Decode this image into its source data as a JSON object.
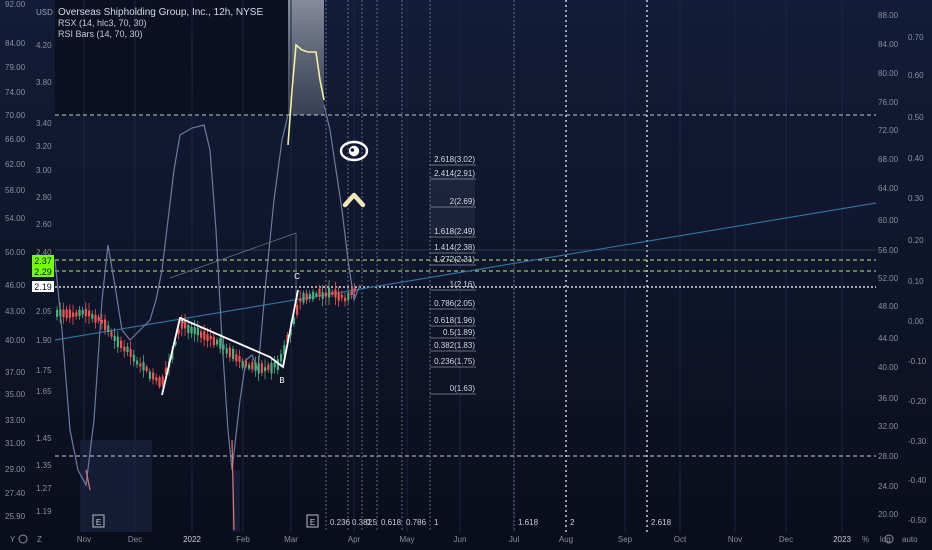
{
  "legend": {
    "title": "Overseas Shipholding Group, Inc., 12h, NYSE",
    "line2": "RSX (14, hlc3, 70, 30)",
    "line3": "RSI Bars (14, 70, 30)",
    "currency": "USD"
  },
  "colors": {
    "background_top": "#10182f",
    "background_bottom": "#0b0f1e",
    "price_marker": "#ffffff",
    "up_candle": "#4caf7d",
    "down_candle": "#ef5350",
    "label_green": "#76ff03",
    "rsx_line": "#6c7a9c",
    "highlight_line": "#f0f0a0",
    "trend_line": "#2f6f9a",
    "fib_line": "#8a8f9e"
  },
  "axes": {
    "left_ticks": [
      "92.00",
      "84.00",
      "79.00",
      "74.00",
      "70.00",
      "66.00",
      "62.00",
      "58.00",
      "54.00",
      "50.00",
      "46.00",
      "43.00",
      "40.00",
      "37.00",
      "35.00",
      "33.00",
      "31.00",
      "29.00",
      "27.40",
      "25.90"
    ],
    "inner_left_ticks": [
      "4.20",
      "3.80",
      "3.40",
      "3.20",
      "3.00",
      "2.80",
      "2.60",
      "2.40",
      "2.05",
      "1.90",
      "1.75",
      "1.65",
      "1.45",
      "1.35",
      "1.27",
      "1.19"
    ],
    "right_price_ticks": [
      "88.00",
      "84.00",
      "80.00",
      "76.00",
      "72.00",
      "68.00",
      "64.00",
      "60.00",
      "56.00",
      "52.00",
      "48.00",
      "44.00",
      "40.00",
      "36.00",
      "32.00",
      "28.00",
      "24.00",
      "20.00"
    ],
    "right_osc_ticks": [
      "0.70",
      "0.60",
      "0.50",
      "0.40",
      "0.30",
      "0.20",
      "0.10",
      "0.00",
      "-0.10",
      "-0.20",
      "-0.30",
      "-0.40",
      "-0.50"
    ],
    "x_ticks": [
      "Nov",
      "Dec",
      "2022",
      "Feb",
      "Mar",
      "Apr",
      "May",
      "Jun",
      "Jul",
      "Aug",
      "Sep",
      "Oct",
      "Nov",
      "Dec",
      "2023"
    ],
    "corner_left": [
      "Y",
      "Z"
    ],
    "corner_right": [
      "%",
      "log",
      "auto"
    ]
  },
  "price_labels": {
    "green_top": "2.37",
    "green_bottom": "2.29",
    "current": "2.19"
  },
  "fib_levels": [
    "2.618(3.02)",
    "2.414(2.91)",
    "2(2.69)",
    "1.618(2.49)",
    "1.414(2.38)",
    "1.272(2.31)",
    "1(2.16)",
    "0.786(2.05)",
    "0.618(1.96)",
    "0.5(1.89)",
    "0.382(1.83)",
    "0.236(1.75)",
    "0(1.63)"
  ],
  "time_fib_labels": [
    "0.236",
    "0.382",
    "0.5",
    "0.618",
    "0.786",
    "1",
    "1.618",
    "2",
    "2.618"
  ],
  "wave_labels": [
    "A",
    "B",
    "C"
  ],
  "event_markers": [
    "E",
    "E"
  ]
}
